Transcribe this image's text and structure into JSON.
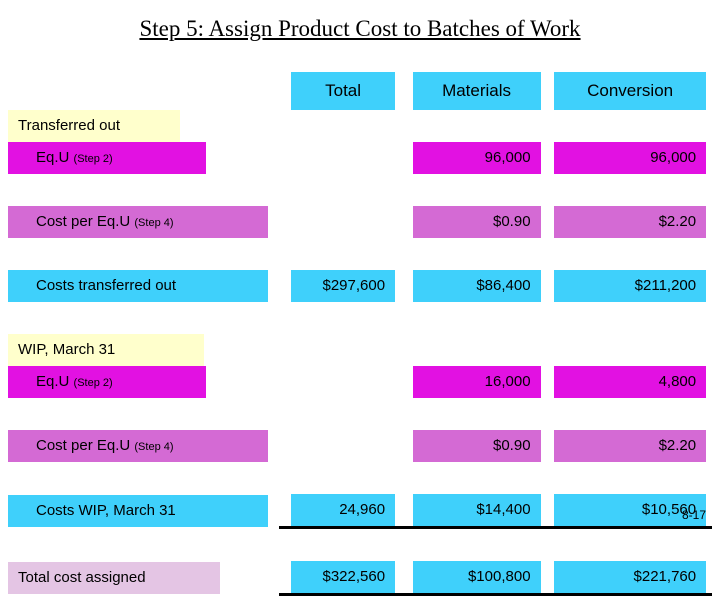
{
  "slide": {
    "title": "Step 5: Assign Product Cost to Batches of Work",
    "page_number": "8-17"
  },
  "columns": {
    "total": "Total",
    "materials": "Materials",
    "conversion": "Conversion"
  },
  "sections": {
    "transferred_out": "Transferred out",
    "wip": "WIP, March 31"
  },
  "rows": {
    "equ_to": {
      "label": "Eq.U",
      "note": "(Step 2)",
      "total": "",
      "materials": "96,000",
      "conversion": "96,000"
    },
    "cost_per_equ_to": {
      "label": "Cost per Eq.U",
      "note": "(Step 4)",
      "total": "",
      "materials": "$0.90",
      "conversion": "$2.20"
    },
    "costs_transferred_out": {
      "label": "Costs transferred out",
      "note": "",
      "total": "$297,600",
      "materials": "$86,400",
      "conversion": "$211,200"
    },
    "equ_wip": {
      "label": "Eq.U",
      "note": "(Step 2)",
      "total": "",
      "materials": "16,000",
      "conversion": "4,800"
    },
    "cost_per_equ_wip": {
      "label": "Cost per Eq.U",
      "note": "(Step 4)",
      "total": "",
      "materials": "$0.90",
      "conversion": "$2.20"
    },
    "costs_wip": {
      "label": "Costs WIP, March 31",
      "note": "",
      "total": "24,960",
      "materials": "$14,400",
      "conversion": "$10,560"
    },
    "total_cost_assigned": {
      "label": "Total cost assigned",
      "note": "",
      "total": "$322,560",
      "materials": "$100,800",
      "conversion": "$221,760"
    }
  },
  "colors": {
    "cyan": "#3fd0fb",
    "magenta": "#e211e2",
    "light_magenta": "#d46ad4",
    "pink": "#e4c5e4",
    "cream": "#ffffcc"
  }
}
